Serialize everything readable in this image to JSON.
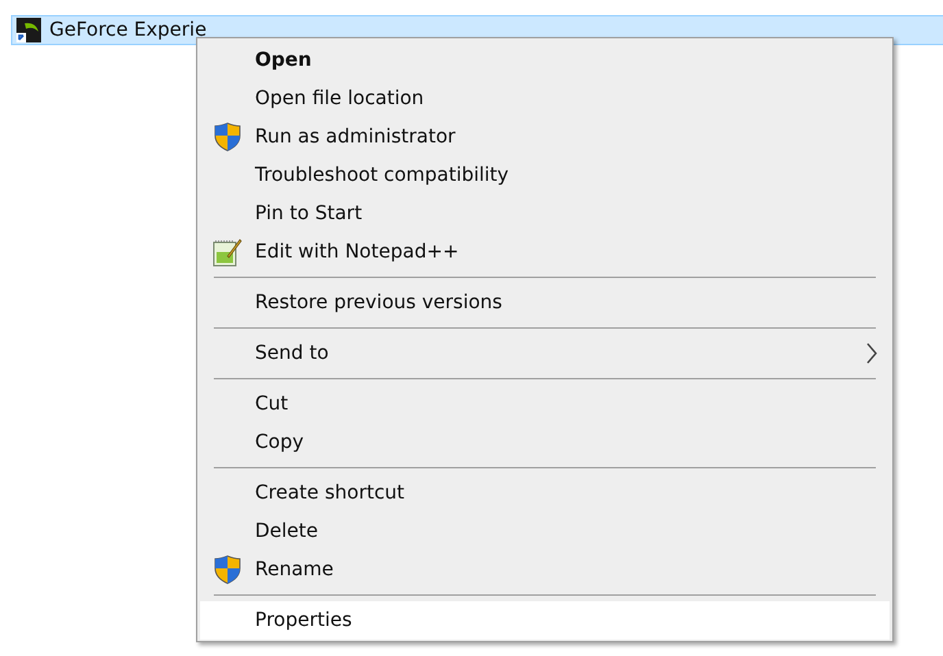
{
  "file_row": {
    "name": "GeForce Experie",
    "selected": true
  },
  "context_menu": {
    "items": [
      {
        "kind": "plain",
        "label": "Open",
        "default": true,
        "selected": false
      },
      {
        "kind": "plain",
        "label": "Open file location",
        "default": false,
        "selected": false
      },
      {
        "kind": "shield",
        "label": "Run as administrator",
        "default": false,
        "selected": false
      },
      {
        "kind": "plain",
        "label": "Troubleshoot compatibility",
        "default": false,
        "selected": false
      },
      {
        "kind": "plain",
        "label": "Pin to Start",
        "default": false,
        "selected": false
      },
      {
        "kind": "notepad",
        "label": "Edit with Notepad++",
        "default": false,
        "selected": false
      },
      {
        "kind": "separator"
      },
      {
        "kind": "plain",
        "label": "Restore previous versions",
        "default": false,
        "selected": false
      },
      {
        "kind": "separator"
      },
      {
        "kind": "submenu",
        "label": "Send to",
        "default": false,
        "selected": false
      },
      {
        "kind": "separator"
      },
      {
        "kind": "plain",
        "label": "Cut",
        "default": false,
        "selected": false
      },
      {
        "kind": "plain",
        "label": "Copy",
        "default": false,
        "selected": false
      },
      {
        "kind": "separator"
      },
      {
        "kind": "plain",
        "label": "Create shortcut",
        "default": false,
        "selected": false
      },
      {
        "kind": "plain",
        "label": "Delete",
        "default": false,
        "selected": false
      },
      {
        "kind": "shield",
        "label": "Rename",
        "default": false,
        "selected": false
      },
      {
        "kind": "separator"
      },
      {
        "kind": "plain",
        "label": "Properties",
        "default": false,
        "selected": true
      }
    ]
  }
}
